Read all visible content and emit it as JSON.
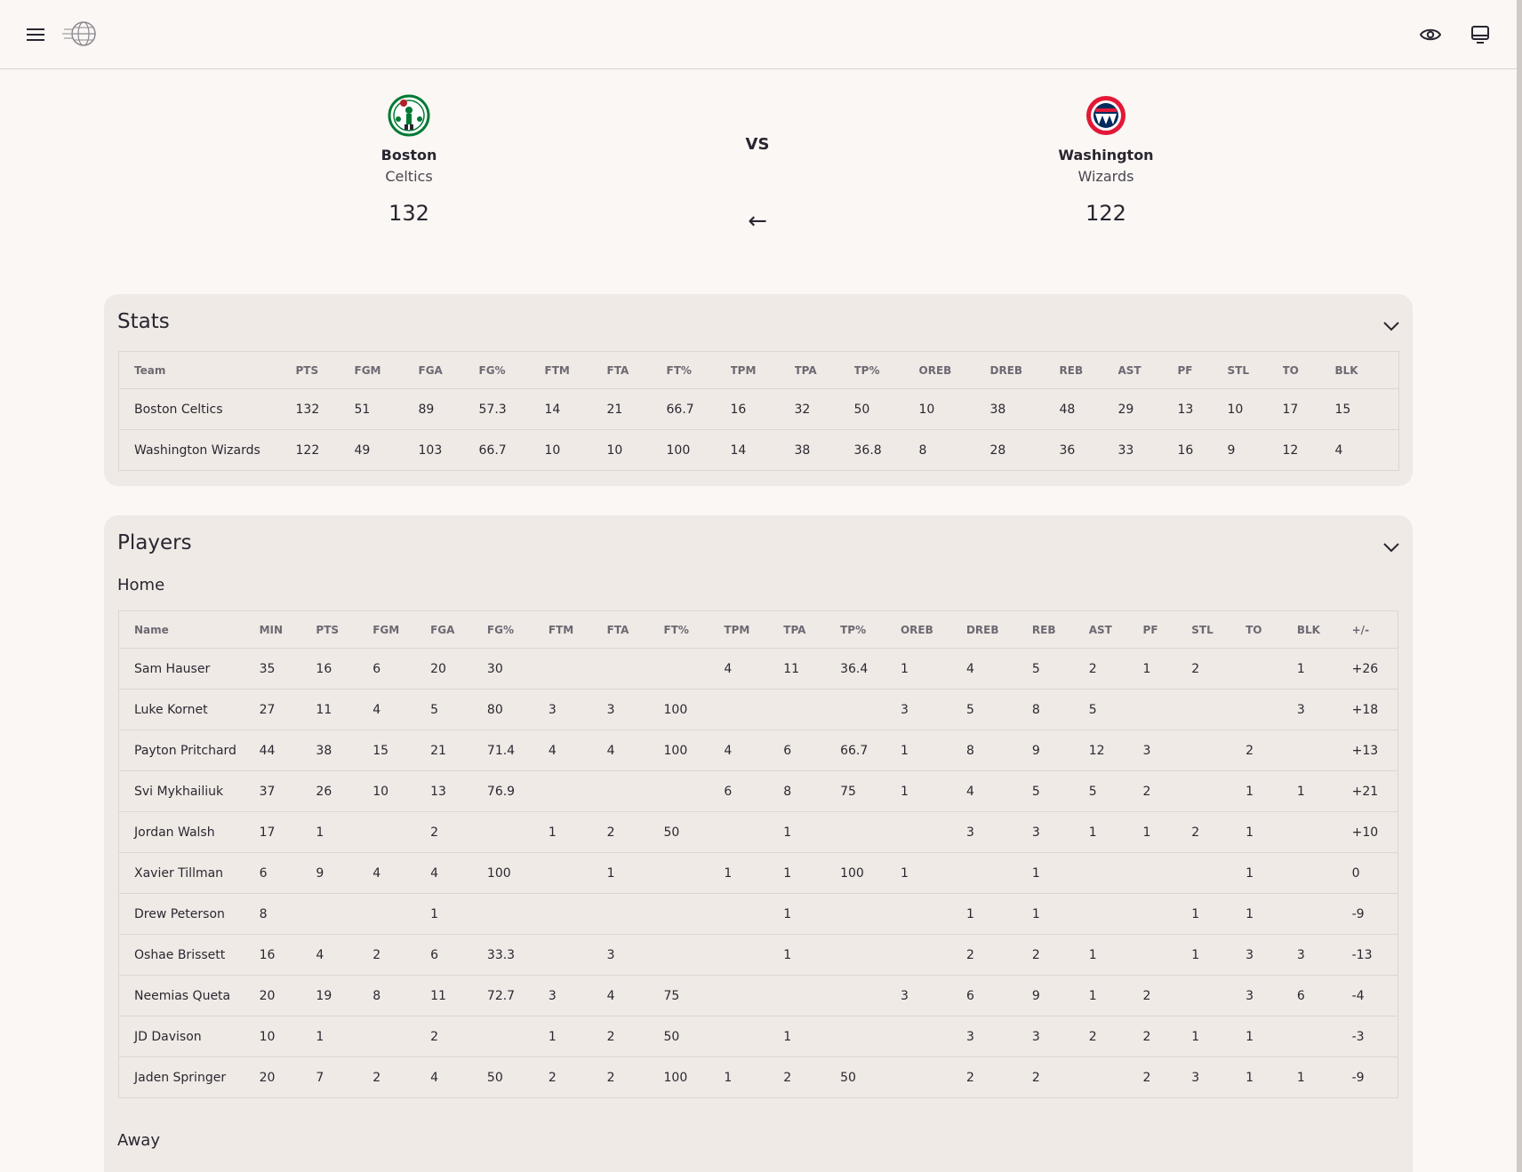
{
  "app": {
    "menu_icon": "hamburger-menu-icon",
    "logo_icon": "globe-logo-icon",
    "view_icon": "eye-icon",
    "display_icon": "monitor-icon"
  },
  "matchup": {
    "home": {
      "city": "Boston",
      "name": "Celtics",
      "score": "132",
      "logo_icon": "celtics-logo-icon",
      "color": "#007a33"
    },
    "away": {
      "city": "Washington",
      "name": "Wizards",
      "score": "122",
      "logo_icon": "wizards-logo-icon",
      "color": "#e31837"
    },
    "vs_label": "VS",
    "arrow": "←"
  },
  "stats": {
    "title": "Stats",
    "columns": [
      "Team",
      "PTS",
      "FGM",
      "FGA",
      "FG%",
      "FTM",
      "FTA",
      "FT%",
      "TPM",
      "TPA",
      "TP%",
      "OREB",
      "DREB",
      "REB",
      "AST",
      "PF",
      "STL",
      "TO",
      "BLK"
    ],
    "rows": [
      [
        "Boston Celtics",
        "132",
        "51",
        "89",
        "57.3",
        "14",
        "21",
        "66.7",
        "16",
        "32",
        "50",
        "10",
        "38",
        "48",
        "29",
        "13",
        "10",
        "17",
        "15"
      ],
      [
        "Washington Wizards",
        "122",
        "49",
        "103",
        "66.7",
        "10",
        "10",
        "100",
        "14",
        "38",
        "36.8",
        "8",
        "28",
        "36",
        "33",
        "16",
        "9",
        "12",
        "4"
      ]
    ]
  },
  "players": {
    "title": "Players",
    "home_label": "Home",
    "away_label": "Away",
    "columns": [
      "Name",
      "MIN",
      "PTS",
      "FGM",
      "FGA",
      "FG%",
      "FTM",
      "FTA",
      "FT%",
      "TPM",
      "TPA",
      "TP%",
      "OREB",
      "DREB",
      "REB",
      "AST",
      "PF",
      "STL",
      "TO",
      "BLK",
      "+/-"
    ],
    "home_rows": [
      [
        "Sam Hauser",
        "35",
        "16",
        "6",
        "20",
        "30",
        "",
        "",
        "",
        "4",
        "11",
        "36.4",
        "1",
        "4",
        "5",
        "2",
        "1",
        "2",
        "",
        "1",
        "+26"
      ],
      [
        "Luke Kornet",
        "27",
        "11",
        "4",
        "5",
        "80",
        "3",
        "3",
        "100",
        "",
        "",
        "",
        "3",
        "5",
        "8",
        "5",
        "",
        "",
        "",
        "3",
        "+18"
      ],
      [
        "Payton Pritchard",
        "44",
        "38",
        "15",
        "21",
        "71.4",
        "4",
        "4",
        "100",
        "4",
        "6",
        "66.7",
        "1",
        "8",
        "9",
        "12",
        "3",
        "",
        "2",
        "",
        "+13"
      ],
      [
        "Svi Mykhailiuk",
        "37",
        "26",
        "10",
        "13",
        "76.9",
        "",
        "",
        "",
        "6",
        "8",
        "75",
        "1",
        "4",
        "5",
        "5",
        "2",
        "",
        "1",
        "1",
        "+21"
      ],
      [
        "Jordan Walsh",
        "17",
        "1",
        "",
        "2",
        "",
        "1",
        "2",
        "50",
        "",
        "1",
        "",
        "",
        "3",
        "3",
        "1",
        "1",
        "2",
        "1",
        "",
        "+10"
      ],
      [
        "Xavier Tillman",
        "6",
        "9",
        "4",
        "4",
        "100",
        "",
        "1",
        "",
        "1",
        "1",
        "100",
        "1",
        "",
        "1",
        "",
        "",
        "",
        "1",
        "",
        "0"
      ],
      [
        "Drew Peterson",
        "8",
        "",
        "",
        "1",
        "",
        "",
        "",
        "",
        "",
        "1",
        "",
        "",
        "1",
        "1",
        "",
        "",
        "1",
        "1",
        "",
        "-9"
      ],
      [
        "Oshae Brissett",
        "16",
        "4",
        "2",
        "6",
        "33.3",
        "",
        "3",
        "",
        "",
        "1",
        "",
        "",
        "2",
        "2",
        "1",
        "",
        "1",
        "3",
        "3",
        "-13"
      ],
      [
        "Neemias Queta",
        "20",
        "19",
        "8",
        "11",
        "72.7",
        "3",
        "4",
        "75",
        "",
        "",
        "",
        "3",
        "6",
        "9",
        "1",
        "2",
        "",
        "3",
        "6",
        "-4"
      ],
      [
        "JD Davison",
        "10",
        "1",
        "",
        "2",
        "",
        "1",
        "2",
        "50",
        "",
        "1",
        "",
        "",
        "3",
        "3",
        "2",
        "2",
        "1",
        "1",
        "",
        "-3"
      ],
      [
        "Jaden Springer",
        "20",
        "7",
        "2",
        "4",
        "50",
        "2",
        "2",
        "100",
        "1",
        "2",
        "50",
        "",
        "2",
        "2",
        "",
        "2",
        "3",
        "1",
        "1",
        "-9"
      ]
    ]
  }
}
